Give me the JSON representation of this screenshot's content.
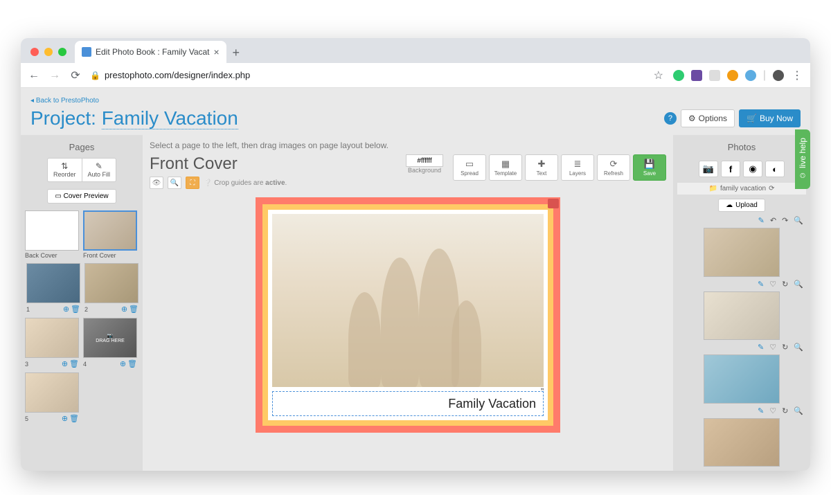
{
  "browser": {
    "tab_title": "Edit Photo Book : Family Vacat",
    "url": "prestophoto.com/designer/index.php"
  },
  "header": {
    "back_link": "Back to PrestoPhoto",
    "project_prefix": "Project: ",
    "project_name": "Family Vacation",
    "options_label": "Options",
    "buy_label": "Buy Now"
  },
  "left_panel": {
    "title": "Pages",
    "reorder": "Reorder",
    "autofill": "Auto Fill",
    "cover_preview": "Cover Preview",
    "pages": [
      {
        "label": "Back Cover"
      },
      {
        "label": "Front Cover"
      },
      {
        "label": "1"
      },
      {
        "label": "2"
      },
      {
        "label": "3"
      },
      {
        "label": "4"
      },
      {
        "label": "5"
      }
    ],
    "drag_here": "DRAG HERE"
  },
  "center": {
    "hint": "Select a page to the left, then drag images on page layout below.",
    "page_title": "Front Cover",
    "crop_text_pre": "Crop guides are ",
    "crop_text_active": "active",
    "bg_value": "#ffffff",
    "bg_label": "Background",
    "tools": {
      "spread": "Spread",
      "template": "Template",
      "text": "Text",
      "layers": "Layers",
      "refresh": "Refresh",
      "save": "Save"
    },
    "caption": "Family Vacation"
  },
  "right_panel": {
    "title": "Photos",
    "album": "family vacation",
    "upload": "Upload"
  },
  "livehelp": "live help"
}
